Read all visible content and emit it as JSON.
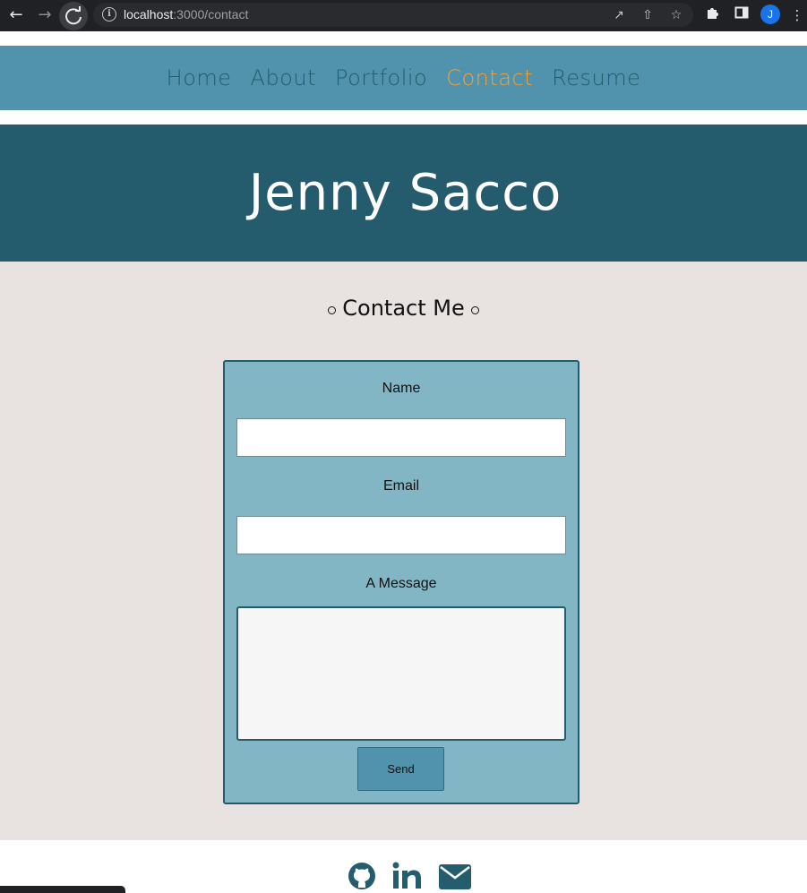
{
  "browser": {
    "url_host": "localhost",
    "url_path": ":3000/contact",
    "avatar_letter": "J"
  },
  "nav": {
    "items": [
      {
        "label": "Home",
        "active": false
      },
      {
        "label": "About",
        "active": false
      },
      {
        "label": "Portfolio",
        "active": false
      },
      {
        "label": "Contact",
        "active": true
      },
      {
        "label": "Resume",
        "active": false
      }
    ]
  },
  "hero": {
    "title": "Jenny Sacco"
  },
  "contact": {
    "heading": "Contact Me",
    "name_label": "Name",
    "name_value": "",
    "email_label": "Email",
    "email_value": "",
    "message_label": "A Message",
    "message_value": "",
    "send_label": "Send"
  },
  "footer": {
    "icons": [
      "github-icon",
      "linkedin-icon",
      "envelope-icon"
    ]
  },
  "colors": {
    "nav_bg": "#5192ad",
    "hero_bg": "#255c6d",
    "active_link": "#f2a037",
    "main_bg": "#e8e3e0",
    "form_bg": "#83b6c4"
  }
}
